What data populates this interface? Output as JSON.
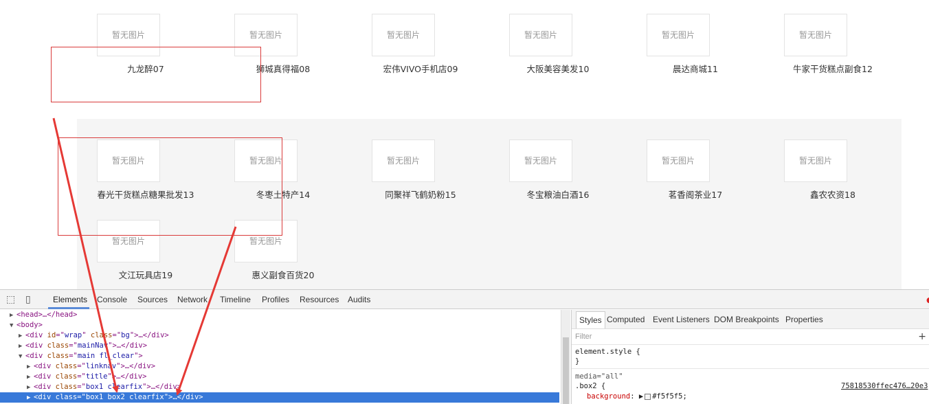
{
  "placeholder_text": "暂无图片",
  "shops_row1": [
    "九龙醉07",
    "狮城真得福08",
    "宏伟VIVO手机店09",
    "大阪美容美发10",
    "晨达商城11",
    "牛家干货糕点副食12"
  ],
  "shops_row2": [
    "春光干货糕点糖果批发13",
    "冬枣土特产14",
    "同聚祥飞鹤奶粉15",
    "冬宝粮油白酒16",
    "茗香阁茶业17",
    "鑫农农资18"
  ],
  "shops_row3": [
    "文江玩具店19",
    "惠义副食百货20"
  ],
  "colors": {
    "band": "#f5f5f5",
    "annotation": "#e53935",
    "selection": "#3879d9"
  },
  "devtools": {
    "tabs": [
      "Elements",
      "Console",
      "Sources",
      "Network",
      "Timeline",
      "Profiles",
      "Resources",
      "Audits"
    ],
    "active_tab": "Elements",
    "icons": [
      "inspect-icon",
      "device-icon"
    ],
    "tree": [
      {
        "tri": "▶",
        "html": "<head>…</head>"
      },
      {
        "tri": "▼",
        "html": "<body>"
      },
      {
        "tri": "▶",
        "tag": "div",
        "attrs": [
          [
            "id",
            "wrap"
          ],
          [
            "class",
            "bg"
          ]
        ],
        "tail": "…</div>"
      },
      {
        "tri": "▶",
        "tag": "div",
        "attrs": [
          [
            "class",
            "mainNav"
          ]
        ],
        "tail": "…</div>"
      },
      {
        "tri": "▼",
        "tag": "div",
        "attrs": [
          [
            "class",
            "main fl_clear"
          ]
        ],
        "tail": ""
      },
      {
        "tri": "▶",
        "tag": "div",
        "attrs": [
          [
            "class",
            "linknav"
          ]
        ],
        "tail": "…</div>"
      },
      {
        "tri": "▶",
        "tag": "div",
        "attrs": [
          [
            "class",
            "title"
          ]
        ],
        "tail": "…</div>"
      },
      {
        "tri": "▶",
        "tag": "div",
        "attrs": [
          [
            "class",
            "box1 clearfix"
          ]
        ],
        "tail": "…</div>"
      },
      {
        "tri": "▶",
        "tag": "div",
        "attrs": [
          [
            "class",
            "box1 box2 clearfix"
          ]
        ],
        "tail": "…</div>",
        "selected": true
      }
    ],
    "styles_tabs": [
      "Styles",
      "Computed",
      "Event Listeners",
      "DOM Breakpoints",
      "Properties"
    ],
    "filter_placeholder": "Filter",
    "add_rule": "+",
    "element_style": "element.style {",
    "close_brace": "}",
    "media": "media=\"all\"",
    "selector": ".box2 {",
    "property": "background",
    "value": "#f5f5f5;",
    "source_link": "75818530ffec476…20e3"
  }
}
